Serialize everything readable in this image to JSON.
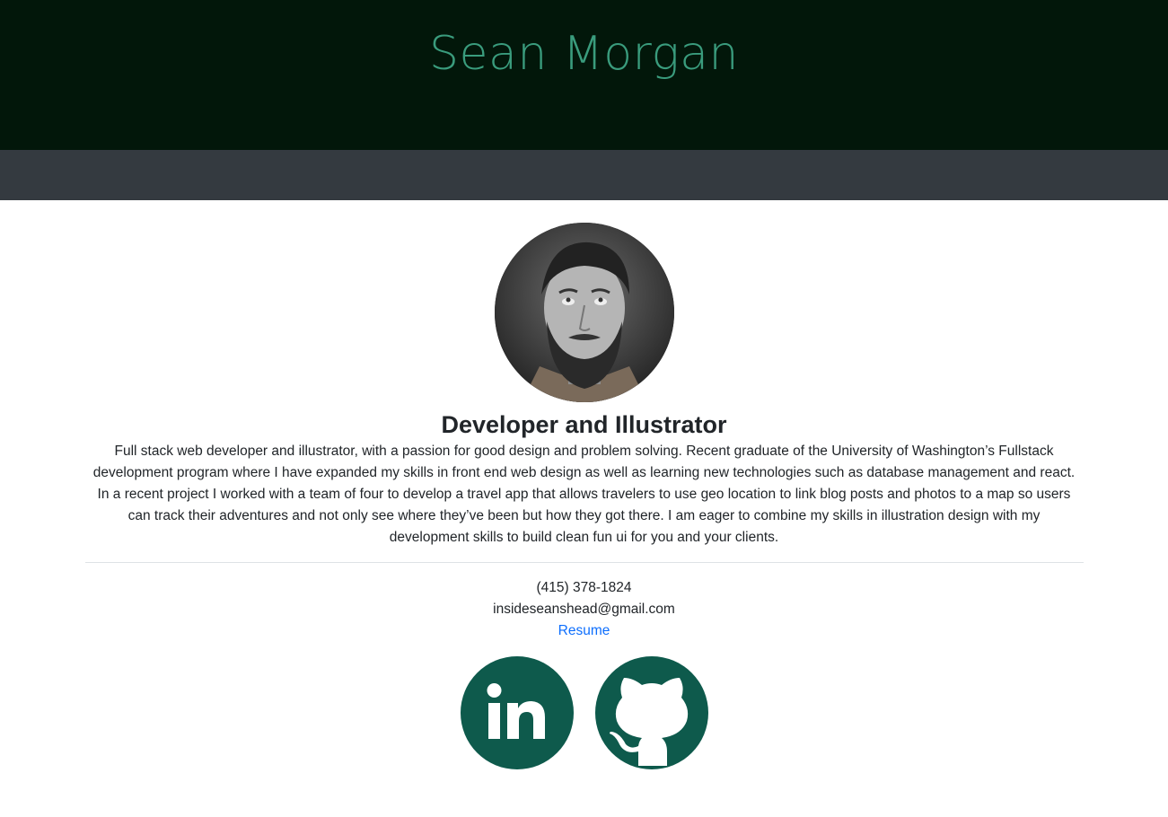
{
  "header": {
    "name": "Sean Morgan"
  },
  "profile": {
    "headline": "Developer and Illustrator",
    "bio": "Full stack web developer and illustrator, with a passion for good design and problem solving. Recent graduate of the University of Washington’s Fullstack development program where I have expanded my skills in front end web design as well as learning new technologies such as database management and react. In a recent project I worked with a team of four to develop a travel app that allows travelers to use geo location to link blog posts and photos to a map so users can track their adventures and not only see where they’ve been but how they got there. I am eager to combine my skills in illustration design with my development skills to build clean fun ui for you and your clients."
  },
  "contact": {
    "phone": "(415) 378-1824",
    "email": "insideseanshead@gmail.com",
    "resume_label": "Resume"
  },
  "socials": [
    {
      "icon": "linkedin-icon"
    },
    {
      "icon": "github-icon"
    }
  ],
  "colors": {
    "header_bg": "#02170a",
    "header_text": "#3a9c7d",
    "navbar_bg": "#343a40",
    "social_bg": "#0e5a4c",
    "link": "#0d6efd"
  }
}
